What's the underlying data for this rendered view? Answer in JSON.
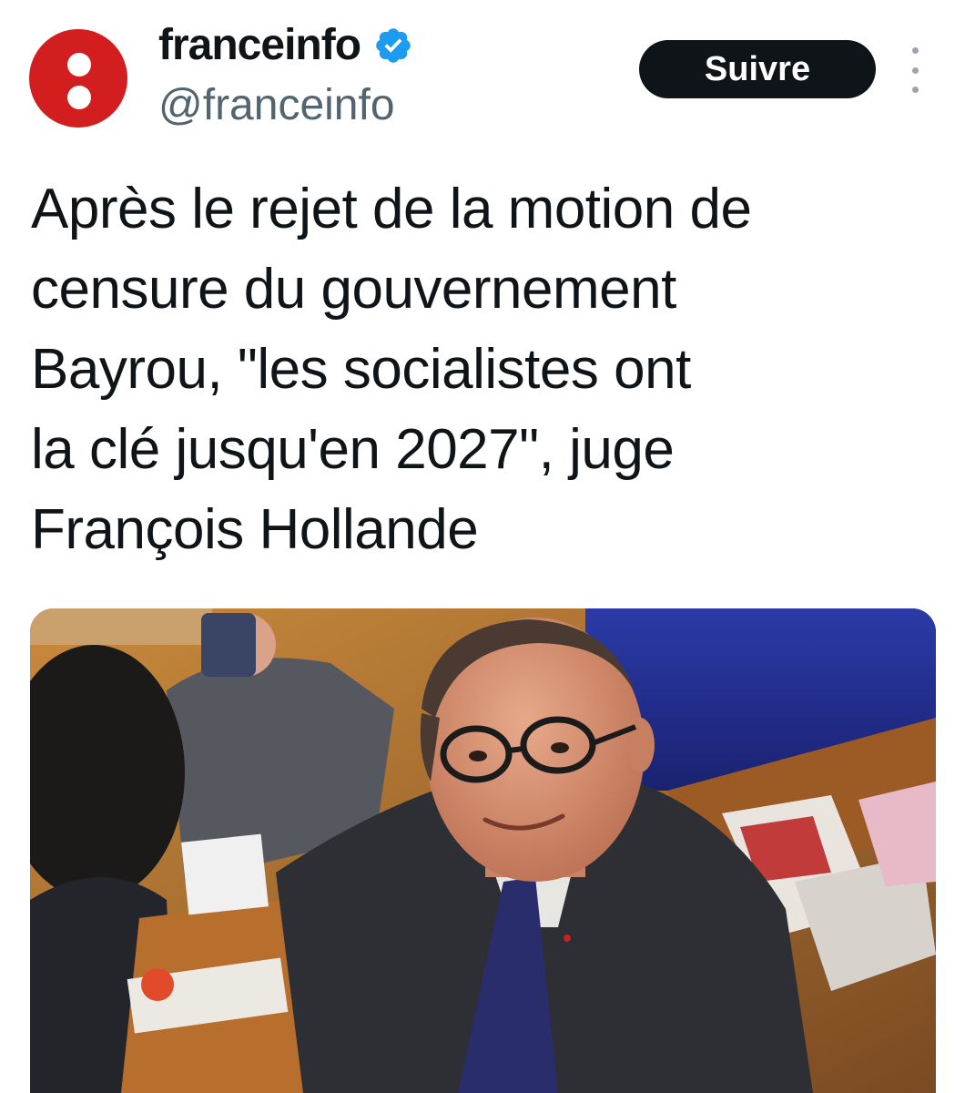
{
  "account": {
    "display_name": "franceinfo",
    "handle": "@franceinfo",
    "verified": true,
    "avatar_icon": "franceinfo-logo-icon",
    "brand_color": "#d21e1e"
  },
  "actions": {
    "follow_label": "Suivre",
    "more_icon": "more-options-icon"
  },
  "tweet": {
    "lines": [
      "Après le rejet de la motion de",
      "censure du gouvernement",
      "Bayrou, \"les socialistes ont",
      "la clé jusqu'en 2027\", juge",
      "François Hollande"
    ]
  },
  "media": {
    "kind": "photo",
    "subject": "man-with-glasses-in-assembly"
  }
}
